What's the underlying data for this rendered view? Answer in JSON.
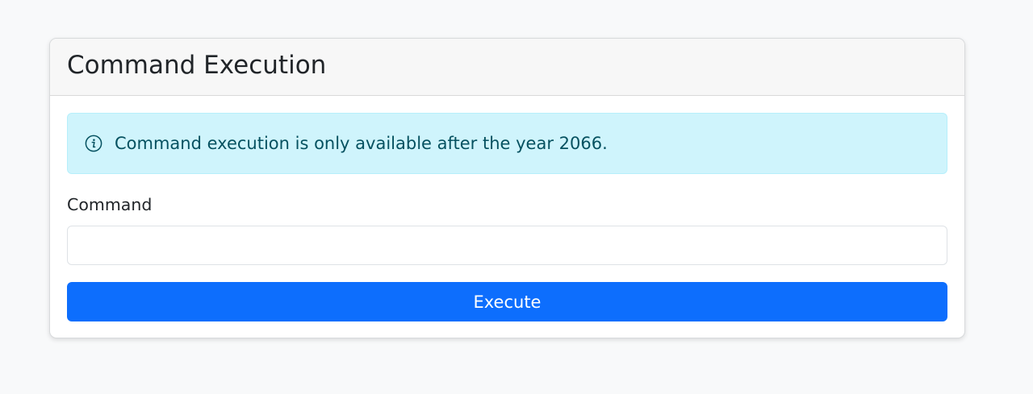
{
  "card": {
    "title": "Command Execution"
  },
  "alert": {
    "icon": "info-circle-icon",
    "message": "Command execution is only available after the year 2066."
  },
  "form": {
    "command_label": "Command",
    "command_value": "",
    "command_placeholder": "",
    "execute_label": "Execute"
  },
  "colors": {
    "page_background": "#f8f9fa",
    "alert_background": "#cff4fc",
    "alert_text": "#055160",
    "primary_button": "#0d6efd"
  }
}
